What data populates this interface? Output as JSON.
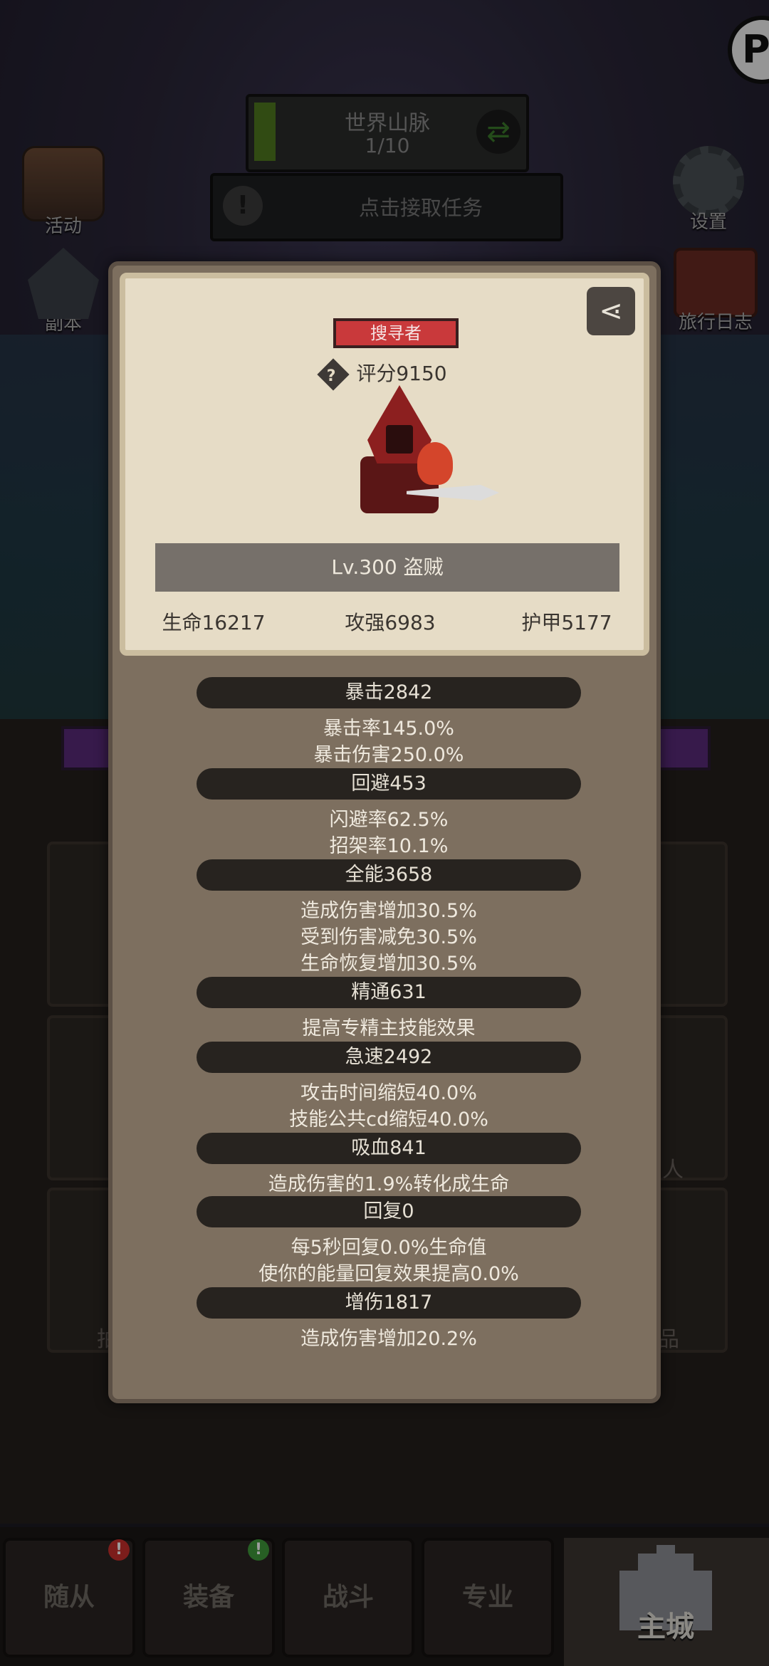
{
  "top": {
    "map_name": "世界山脉",
    "map_count": "1/10",
    "refresh_icon": "refresh-icon",
    "task_label": "点击接取任务",
    "task_icon": "!"
  },
  "side_left": [
    {
      "label": "活动",
      "icon": "event-icon"
    },
    {
      "label": "副本",
      "icon": "dungeon-icon"
    }
  ],
  "side_right": [
    {
      "label": "设置",
      "icon": "gear-icon"
    },
    {
      "label": "旅行日志",
      "icon": "journal-icon"
    }
  ],
  "corner_icon_label": "P",
  "background_cards": {
    "right_mid_text": "人",
    "right_low_text": "品",
    "left_low_text": "拍"
  },
  "modal": {
    "class_tag": "搜寻者",
    "score_icon": "?",
    "score": "评分9150",
    "level": "Lv.300 盗贼",
    "base_stats": [
      "生命16217",
      "攻强6983",
      "护甲5177"
    ],
    "stats": [
      {
        "title": "暴击2842",
        "lines": [
          "暴击率145.0%",
          "暴击伤害250.0%"
        ]
      },
      {
        "title": "回避453",
        "lines": [
          "闪避率62.5%",
          "招架率10.1%"
        ]
      },
      {
        "title": "全能3658",
        "lines": [
          "造成伤害增加30.5%",
          "受到伤害减免30.5%",
          "生命恢复增加30.5%"
        ]
      },
      {
        "title": "精通631",
        "lines": [
          "提高专精主技能效果"
        ]
      },
      {
        "title": "急速2492",
        "lines": [
          "攻击时间缩短40.0%",
          "技能公共cd缩短40.0%"
        ]
      },
      {
        "title": "吸血841",
        "lines": [
          "造成伤害的1.9%转化成生命"
        ]
      },
      {
        "title": "回复0",
        "lines": [
          "每5秒回复0.0%生命值",
          "使你的能量回复效果提高0.0%"
        ]
      },
      {
        "title": "增伤1817",
        "lines": [
          "造成伤害增加20.2%"
        ]
      }
    ]
  },
  "nav": {
    "tabs": [
      "随从",
      "装备",
      "战斗",
      "专业"
    ],
    "home": "主城",
    "badges": {
      "red": "!",
      "green": "!"
    }
  },
  "colors": {
    "modal_bg": "#7d6f5f",
    "parchment": "#e6dcc6",
    "class_tag": "#c9393b",
    "stat_bar": "#27231f"
  }
}
